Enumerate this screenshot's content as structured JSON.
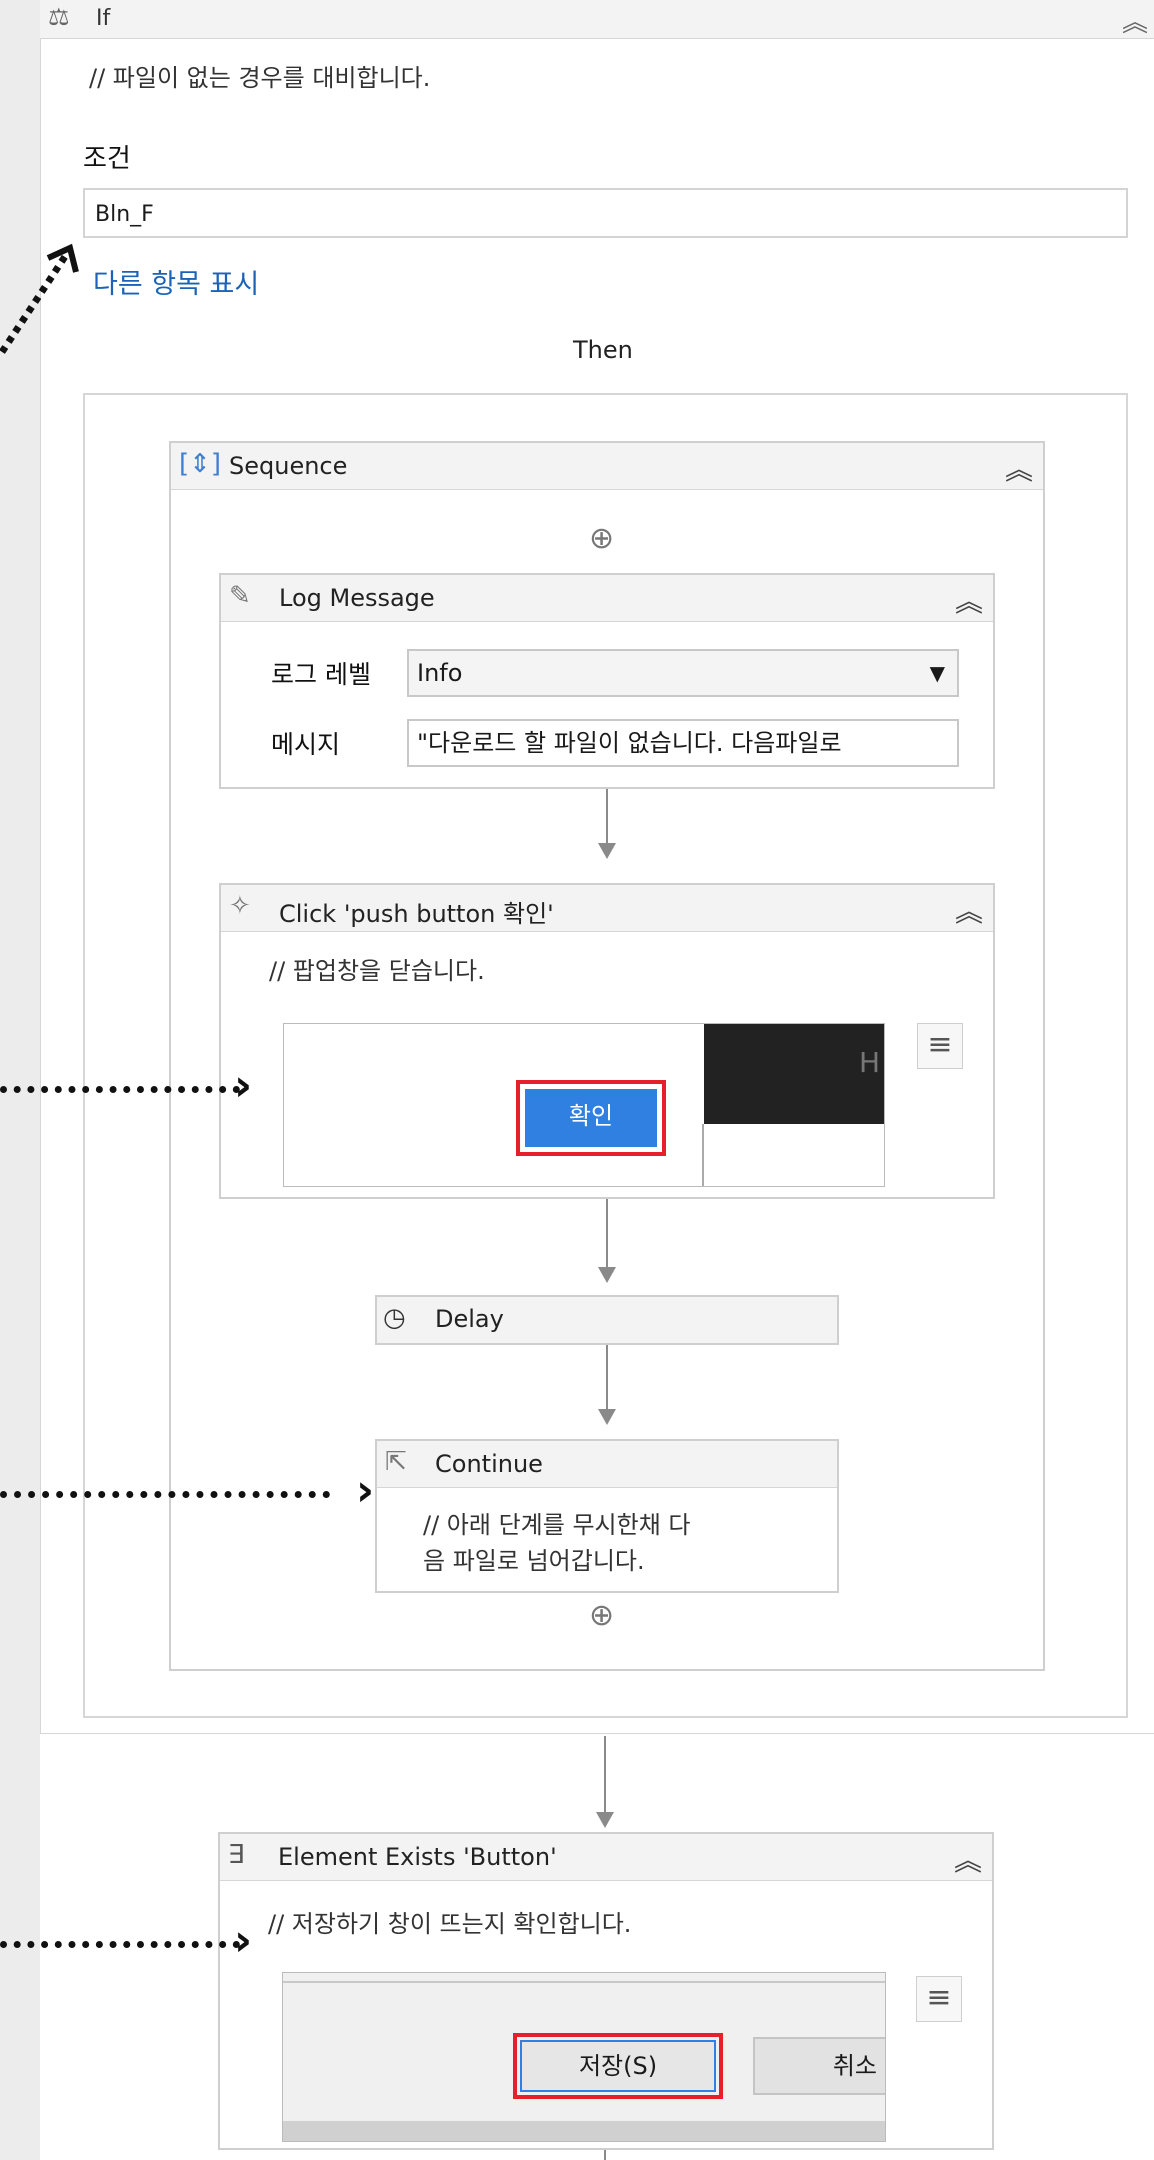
{
  "if_block": {
    "title": "If",
    "comment": "// 파일이 없는 경우를 대비합니다.",
    "condition_label": "조건",
    "condition_value": "Bln_F",
    "more_link": "다른 항목 표시",
    "then_label": "Then"
  },
  "sequence": {
    "title": "Sequence"
  },
  "log_message": {
    "title": "Log Message",
    "level_label": "로그 레벨",
    "level_value": "Info",
    "message_label": "메시지",
    "message_value": "\"다운로드 할 파일이 없습니다. 다음파일로"
  },
  "click": {
    "title": "Click 'push button  확인'",
    "comment": "// 팝업창을 닫습니다.",
    "screenshot_button": "확인",
    "screenshot_edge_text": "H"
  },
  "delay": {
    "title": "Delay"
  },
  "continue": {
    "title": "Continue",
    "comment_line1": "// 아래 단계를 무시한채 다",
    "comment_line2": "음 파일로 넘어갑니다."
  },
  "element_exists": {
    "title": "Element Exists 'Button'",
    "comment": "// 저장하기 창이 뜨는지 확인합니다.",
    "save_button": "저장(S)",
    "cancel_button": "취소"
  },
  "icons": {
    "collapse": "double-chevron-up-icon",
    "plus": "circle-plus-icon",
    "menu": "hamburger-menu-icon"
  },
  "colors": {
    "link": "#1a63b8",
    "highlight_border": "#e5202a",
    "button_blue": "#2f80e0"
  }
}
